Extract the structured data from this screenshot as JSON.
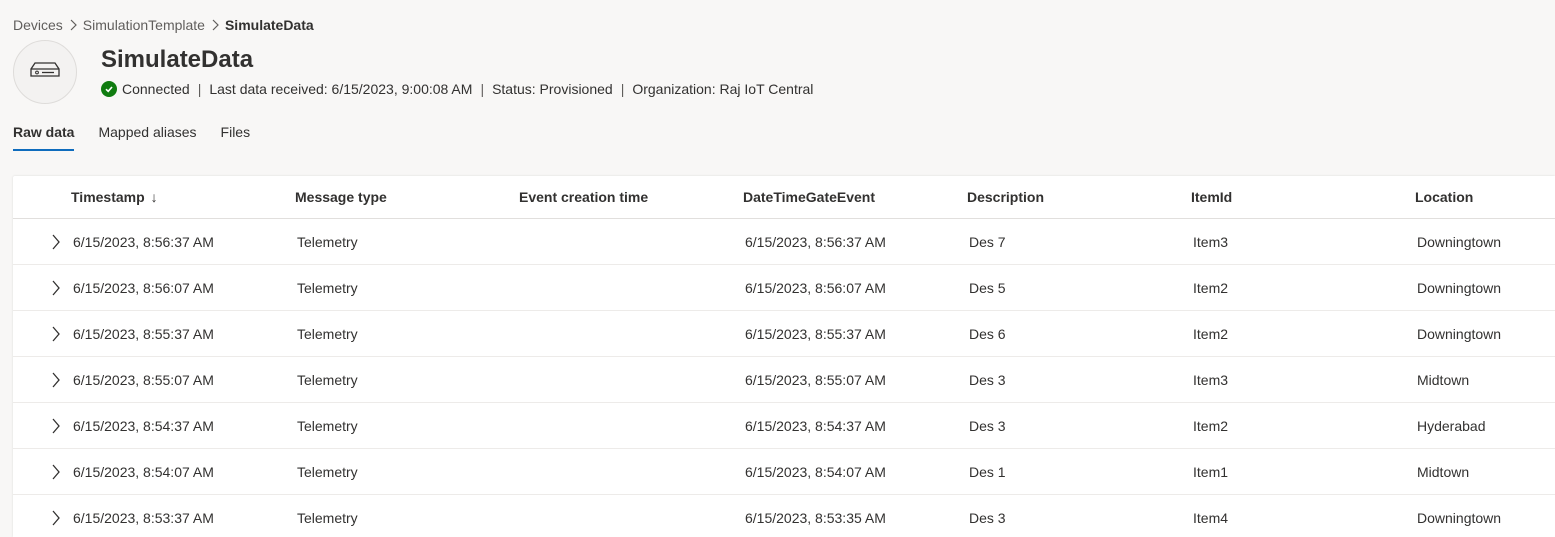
{
  "breadcrumb": {
    "items": [
      "Devices",
      "SimulationTemplate"
    ],
    "current": "SimulateData"
  },
  "device": {
    "icon": "device-icon",
    "name": "SimulateData",
    "connection_status": "Connected",
    "last_data": "Last data received: 6/15/2023, 9:00:08 AM",
    "status": "Status: Provisioned",
    "organization": "Organization: Raj IoT Central",
    "status_color": "#107c10"
  },
  "tabs": [
    {
      "label": "Raw data",
      "active": true
    },
    {
      "label": "Mapped aliases",
      "active": false
    },
    {
      "label": "Files",
      "active": false
    }
  ],
  "table": {
    "sort_indicator": "↓",
    "columns": [
      "Timestamp",
      "Message type",
      "Event creation time",
      "DateTimeGateEvent",
      "Description",
      "ItemId",
      "Location"
    ],
    "rows": [
      [
        "6/15/2023, 8:56:37 AM",
        "Telemetry",
        "",
        "6/15/2023, 8:56:37 AM",
        "Des 7",
        "Item3",
        "Downingtown"
      ],
      [
        "6/15/2023, 8:56:07 AM",
        "Telemetry",
        "",
        "6/15/2023, 8:56:07 AM",
        "Des 5",
        "Item2",
        "Downingtown"
      ],
      [
        "6/15/2023, 8:55:37 AM",
        "Telemetry",
        "",
        "6/15/2023, 8:55:37 AM",
        "Des 6",
        "Item2",
        "Downingtown"
      ],
      [
        "6/15/2023, 8:55:07 AM",
        "Telemetry",
        "",
        "6/15/2023, 8:55:07 AM",
        "Des 3",
        "Item3",
        "Midtown"
      ],
      [
        "6/15/2023, 8:54:37 AM",
        "Telemetry",
        "",
        "6/15/2023, 8:54:37 AM",
        "Des 3",
        "Item2",
        "Hyderabad"
      ],
      [
        "6/15/2023, 8:54:07 AM",
        "Telemetry",
        "",
        "6/15/2023, 8:54:07 AM",
        "Des 1",
        "Item1",
        "Midtown"
      ],
      [
        "6/15/2023, 8:53:37 AM",
        "Telemetry",
        "",
        "6/15/2023, 8:53:35 AM",
        "Des 3",
        "Item4",
        "Downingtown"
      ]
    ]
  },
  "colors": {
    "accent": "#0f6cbd",
    "background": "#f8f7f6"
  }
}
